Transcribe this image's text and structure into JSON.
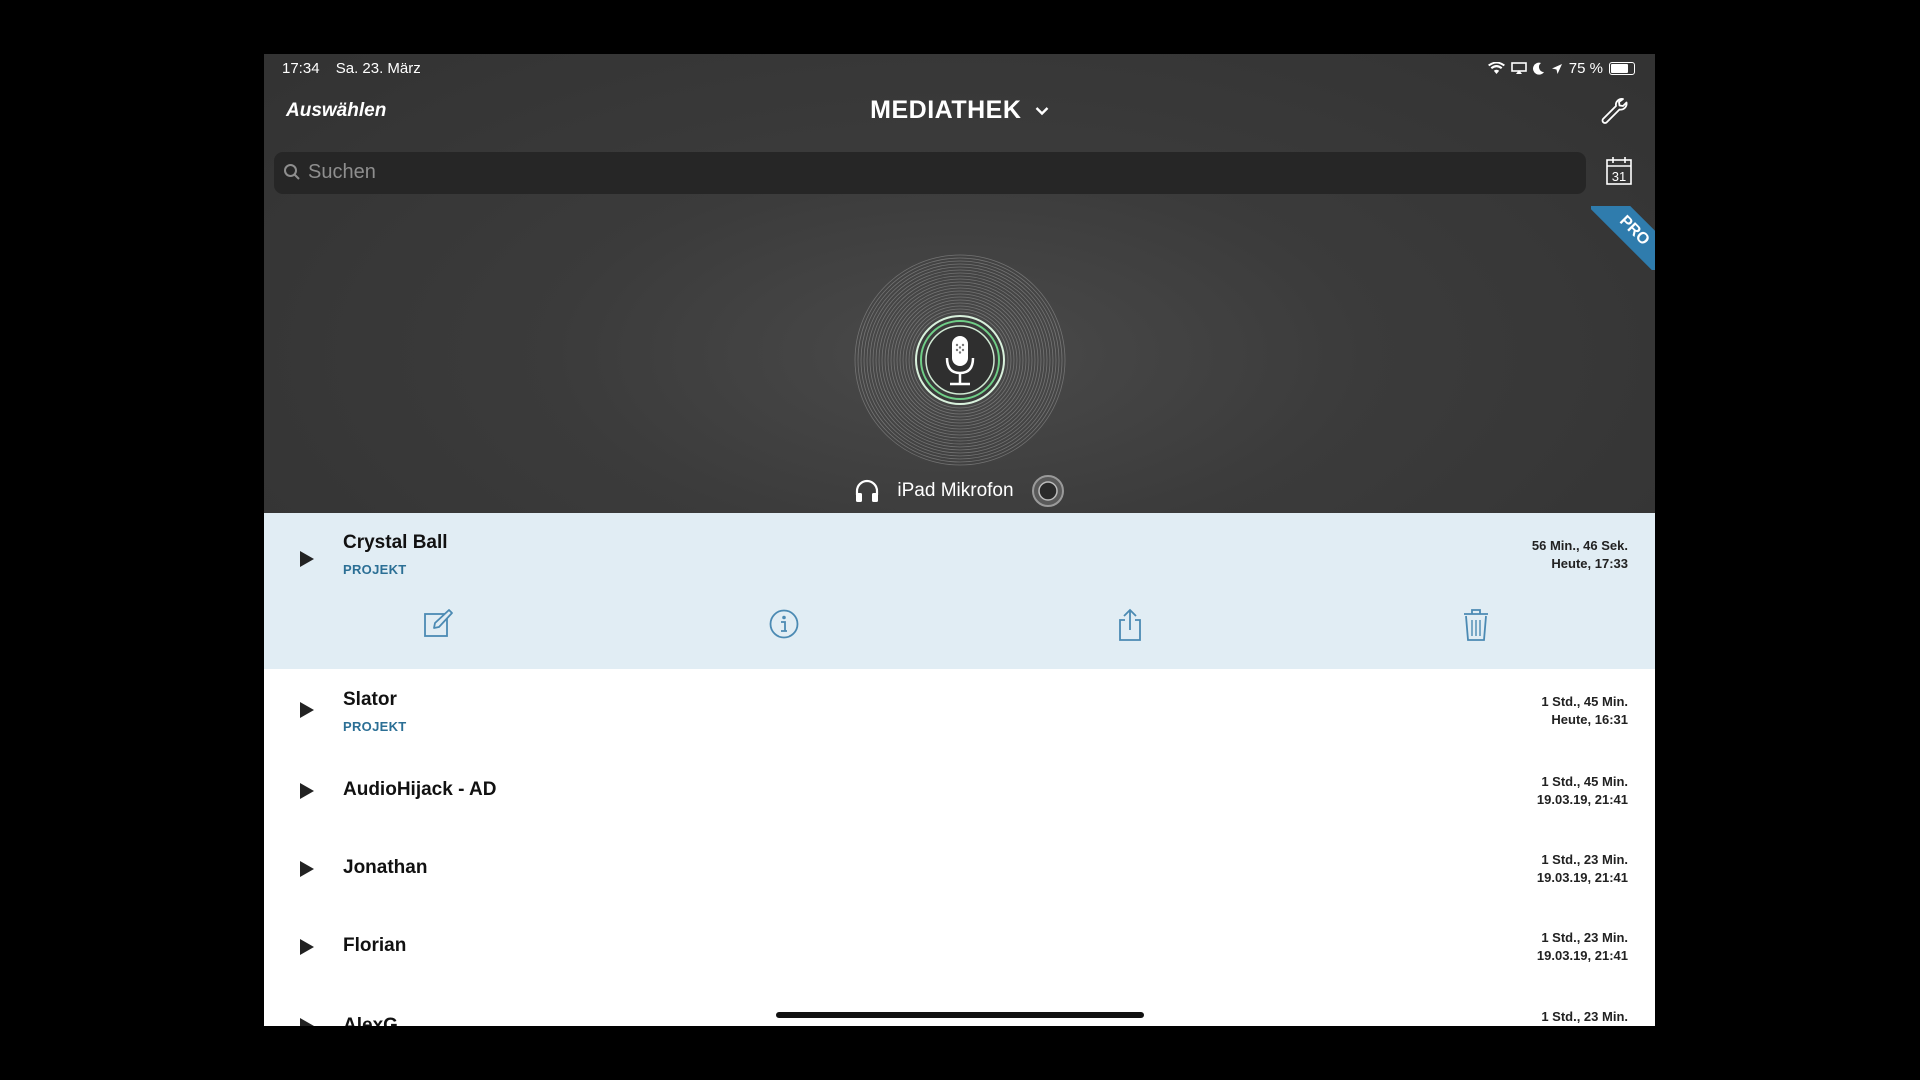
{
  "status": {
    "time": "17:34",
    "date": "Sa. 23. März",
    "battery": "75 %",
    "battery_level": 0.75
  },
  "nav": {
    "select_label": "Auswählen",
    "title": "MEDIATHEK"
  },
  "search": {
    "placeholder": "Suchen"
  },
  "calendar": {
    "day": "31"
  },
  "badge": {
    "pro": "PRO"
  },
  "input": {
    "source": "iPad Mikrofon"
  },
  "selected_item": {
    "name": "Crystal Ball",
    "tag": "PROJEKT",
    "duration": "56 Min., 46 Sek.",
    "date": "Heute, 17:33"
  },
  "items": [
    {
      "name": "Slator",
      "tag": "PROJEKT",
      "duration": "1 Std., 45 Min.",
      "date": "Heute, 16:31"
    },
    {
      "name": "AudioHijack - AD",
      "duration": "1 Std., 45 Min.",
      "date": "19.03.19, 21:41"
    },
    {
      "name": "Jonathan",
      "duration": "1 Std., 23 Min.",
      "date": "19.03.19, 21:41"
    },
    {
      "name": "Florian",
      "duration": "1 Std., 23 Min.",
      "date": "19.03.19, 21:41"
    },
    {
      "name": "AlexG",
      "duration": "1 Std., 23 Min."
    }
  ],
  "actions": [
    "edit-icon",
    "info-icon",
    "share-icon",
    "trash-icon"
  ]
}
